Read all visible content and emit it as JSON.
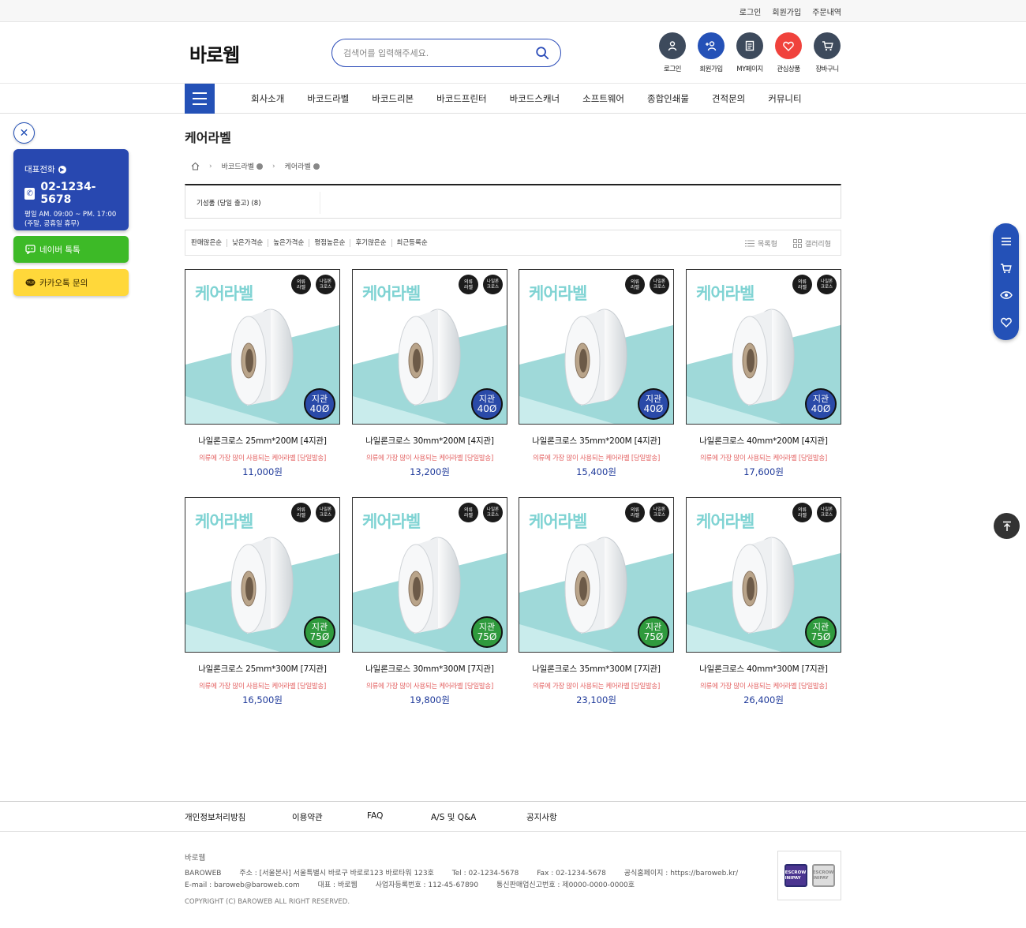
{
  "topbar": {
    "links": [
      "로그인",
      "회원가입",
      "주문내역"
    ]
  },
  "header": {
    "logo": "바로웹",
    "search_placeholder": "검색어를 입력해주세요.",
    "icons": [
      {
        "label": "로그인",
        "icon": "person-icon",
        "color": "#3d4a5c"
      },
      {
        "label": "회원가입",
        "icon": "add-user-icon",
        "color": "#2451b7"
      },
      {
        "label": "MY페이지",
        "icon": "document-icon",
        "color": "#3d4a5c"
      },
      {
        "label": "관심상품",
        "icon": "heart-icon",
        "color": "#f0423c"
      },
      {
        "label": "장바구니",
        "icon": "cart-icon",
        "color": "#3d4a5c"
      }
    ]
  },
  "nav": {
    "items": [
      "회사소개",
      "바코드라벨",
      "바코드리본",
      "바코드프린터",
      "바코드스캐너",
      "소프트웨어",
      "종합인쇄물",
      "견적문의",
      "커뮤니티"
    ]
  },
  "left": {
    "call_title": "대표전화",
    "phone": "02-1234-5678",
    "hours1": "평일 AM. 09:00 ~ PM. 17:00",
    "hours2": "(주말, 공휴일 휴무)",
    "naver": "네이버 톡톡",
    "kakao": "카카오톡 문의"
  },
  "main": {
    "title": "케어라벨",
    "breadcrumb": [
      "바코드라벨",
      "케어라벨"
    ],
    "category": "기성품 (당일 출고) (8)",
    "sorts": [
      "판매많은순",
      "낮은가격순",
      "높은가격순",
      "평점높은순",
      "후기많은순",
      "최근등록순"
    ],
    "view_list": "목록형",
    "view_gallery": "갤러리형"
  },
  "thumb_text": {
    "brand": "케어라벨",
    "badge1_l1": "의류",
    "badge1_l2": "라벨",
    "badge2_l1": "나일론",
    "badge2_l2": "크로스",
    "core": "지관"
  },
  "products": [
    {
      "title": "나일론크로스 25mm*200M [4지관]",
      "desc": "의류에 가장 많이 사용되는 케어라벨 [당일발송]",
      "price": "11,000원",
      "core_size": "40Ø",
      "core_color": "#2a4aa8"
    },
    {
      "title": "나일론크로스 30mm*200M [4지관]",
      "desc": "의류에 가장 많이 사용되는 케어라벨 [당일발송]",
      "price": "13,200원",
      "core_size": "40Ø",
      "core_color": "#2a4aa8"
    },
    {
      "title": "나일론크로스 35mm*200M [4지관]",
      "desc": "의류에 가장 많이 사용되는 케어라벨 [당일발송]",
      "price": "15,400원",
      "core_size": "40Ø",
      "core_color": "#2a4aa8"
    },
    {
      "title": "나일론크로스 40mm*200M [4지관]",
      "desc": "의류에 가장 많이 사용되는 케어라벨 [당일발송]",
      "price": "17,600원",
      "core_size": "40Ø",
      "core_color": "#2a4aa8"
    },
    {
      "title": "나일론크로스 25mm*300M [7지관]",
      "desc": "의류에 가장 많이 사용되는 케어라벨 [당일발송]",
      "price": "16,500원",
      "core_size": "75Ø",
      "core_color": "#2f9a3d"
    },
    {
      "title": "나일론크로스 30mm*300M [7지관]",
      "desc": "의류에 가장 많이 사용되는 케어라벨 [당일발송]",
      "price": "19,800원",
      "core_size": "75Ø",
      "core_color": "#2f9a3d"
    },
    {
      "title": "나일론크로스 35mm*300M [7지관]",
      "desc": "의류에 가장 많이 사용되는 케어라벨 [당일발송]",
      "price": "23,100원",
      "core_size": "75Ø",
      "core_color": "#2f9a3d"
    },
    {
      "title": "나일론크로스 40mm*300M [7지관]",
      "desc": "의류에 가장 많이 사용되는 케어라벨 [당일발송]",
      "price": "26,400원",
      "core_size": "75Ø",
      "core_color": "#2f9a3d"
    }
  ],
  "footer": {
    "links": [
      "개인정보처리방침",
      "이용약관",
      "FAQ",
      "A/S 및 Q&A",
      "공지사항"
    ],
    "company": "바로웹",
    "row1": [
      "BAROWEB",
      "주소 : [서울본사] 서울특별시 바로구 바로로123 바로타워 123호",
      "Tel : 02-1234-5678",
      "Fax : 02-1234-5678",
      "공식홈페이지 : https://baroweb.kr/"
    ],
    "row2": [
      "E-mail : baroweb@baroweb.com",
      "대표 : 바로웹",
      "사업자등록번호 : 112-45-67890",
      "통신판매업신고번호 : 제0000-0000-0000호"
    ],
    "copyright": "COPYRIGHT (C) BAROWEB ALL RIGHT RESERVED.",
    "escrow1": "ESCROW INIPAY",
    "escrow2": "ESCROW INIPAY"
  }
}
